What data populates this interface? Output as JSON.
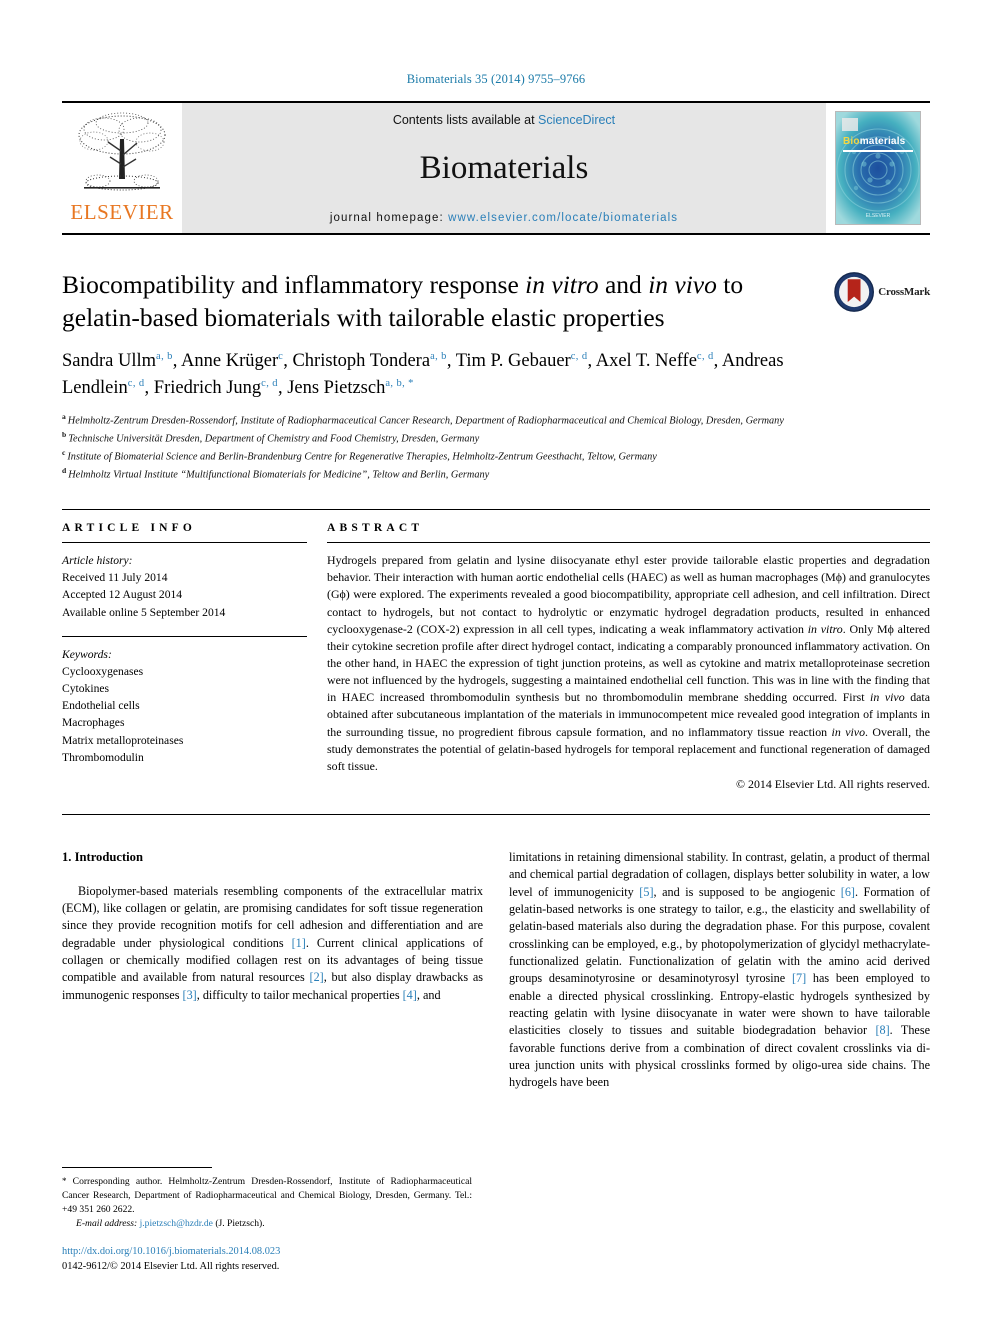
{
  "running_head": "Biomaterials 35 (2014) 9755–9766",
  "masthead": {
    "publisher": "ELSEVIER",
    "contents_prefix": "Contents lists available at ",
    "contents_link": "ScienceDirect",
    "journal_name": "Biomaterials",
    "homepage_prefix": "journal homepage: ",
    "homepage_url": "www.elsevier.com/locate/biomaterials",
    "cover": {
      "title_bio": "Bio",
      "title_materials": "materials",
      "footer": "ELSEVIER"
    }
  },
  "crossmark": {
    "label": "CrossMark"
  },
  "title": {
    "part1": "Biocompatibility and inflammatory response ",
    "em1": "in vitro",
    "part2": " and ",
    "em2": "in vivo",
    "part3": " to gelatin-based biomaterials with tailorable elastic properties"
  },
  "authors": [
    {
      "name": "Sandra Ullm",
      "sup": "a, b"
    },
    {
      "name": "Anne Krüger",
      "sup": "c"
    },
    {
      "name": "Christoph Tondera",
      "sup": "a, b"
    },
    {
      "name": "Tim P. Gebauer",
      "sup": "c, d"
    },
    {
      "name": "Axel T. Neffe",
      "sup": "c, d"
    },
    {
      "name": "Andreas Lendlein",
      "sup": "c, d"
    },
    {
      "name": "Friedrich Jung",
      "sup": "c, d"
    },
    {
      "name": "Jens Pietzsch",
      "sup": "a, b, *"
    }
  ],
  "affiliations": [
    {
      "mark": "a",
      "text": "Helmholtz-Zentrum Dresden-Rossendorf, Institute of Radiopharmaceutical Cancer Research, Department of Radiopharmaceutical and Chemical Biology, Dresden, Germany"
    },
    {
      "mark": "b",
      "text": "Technische Universität Dresden, Department of Chemistry and Food Chemistry, Dresden, Germany"
    },
    {
      "mark": "c",
      "text": "Institute of Biomaterial Science and Berlin-Brandenburg Centre for Regenerative Therapies, Helmholtz-Zentrum Geesthacht, Teltow, Germany"
    },
    {
      "mark": "d",
      "text": "Helmholtz Virtual Institute “Multifunctional Biomaterials for Medicine”, Teltow and Berlin, Germany"
    }
  ],
  "article_info": {
    "heading": "ARTICLE INFO",
    "history_label": "Article history:",
    "history": [
      "Received 11 July 2014",
      "Accepted 12 August 2014",
      "Available online 5 September 2014"
    ],
    "keywords_label": "Keywords:",
    "keywords": [
      "Cyclooxygenases",
      "Cytokines",
      "Endothelial cells",
      "Macrophages",
      "Matrix metalloproteinases",
      "Thrombomodulin"
    ]
  },
  "abstract": {
    "heading": "ABSTRACT",
    "p1": "Hydrogels prepared from gelatin and lysine diisocyanate ethyl ester provide tailorable elastic properties and degradation behavior. Their interaction with human aortic endothelial cells (HAEC) as well as human macrophages (Mϕ) and granulocytes (Gϕ) were explored. The experiments revealed a good biocompatibility, appropriate cell adhesion, and cell infiltration. Direct contact to hydrogels, but not contact to hydrolytic or enzymatic hydrogel degradation products, resulted in enhanced cyclooxygenase-2 (COX-2) expression in all cell types, indicating a weak inflammatory activation ",
    "em1": "in vitro",
    "p2": ". Only Mϕ altered their cytokine secretion profile after direct hydrogel contact, indicating a comparably pronounced inflammatory activation. On the other hand, in HAEC the expression of tight junction proteins, as well as cytokine and matrix metalloproteinase secretion were not influenced by the hydrogels, suggesting a maintained endothelial cell function. This was in line with the finding that in HAEC increased thrombomodulin synthesis but no thrombomodulin membrane shedding occurred. First ",
    "em2": "in vivo",
    "p3": " data obtained after subcutaneous implantation of the materials in immunocompetent mice revealed good integration of implants in the surrounding tissue, no progredient fibrous capsule formation, and no inflammatory tissue reaction ",
    "em3": "in vivo",
    "p4": ". Overall, the study demonstrates the potential of gelatin-based hydrogels for temporal replacement and functional regeneration of damaged soft tissue.",
    "copyright": "© 2014 Elsevier Ltd. All rights reserved."
  },
  "introduction": {
    "heading": "1. Introduction",
    "left_p1_a": "Biopolymer-based materials resembling components of the extracellular matrix (ECM), like collagen or gelatin, are promising candidates for soft tissue regeneration since they provide recognition motifs for cell adhesion and differentiation and are degradable under physiological conditions ",
    "ref1": "[1]",
    "left_p1_b": ". Current clinical applications of collagen or chemically modified collagen rest on its advantages of being tissue compatible and available from natural resources ",
    "ref2": "[2]",
    "left_p1_c": ", but also display drawbacks as immunogenic responses ",
    "ref3": "[3]",
    "left_p1_d": ", difficulty to tailor mechanical properties ",
    "ref4": "[4]",
    "left_p1_e": ", and",
    "right_a": "limitations in retaining dimensional stability. In contrast, gelatin, a product of thermal and chemical partial degradation of collagen, displays better solubility in water, a low level of immunogenicity ",
    "ref5": "[5]",
    "right_b": ", and is supposed to be angiogenic ",
    "ref6": "[6]",
    "right_c": ". Formation of gelatin-based networks is one strategy to tailor, e.g., the elasticity and swellability of gelatin-based materials also during the degradation phase. For this purpose, covalent crosslinking can be employed, e.g., by photopolymerization of glycidyl methacrylate-functionalized gelatin. Functionalization of gelatin with the amino acid derived groups desaminotyrosine or desaminotyrosyl tyrosine ",
    "ref7": "[7]",
    "right_d": " has been employed to enable a directed physical crosslinking. Entropy-elastic hydrogels synthesized by reacting gelatin with lysine diisocyanate in water were shown to have tailorable elasticities closely to tissues and suitable biodegradation behavior ",
    "ref8": "[8]",
    "right_e": ". These favorable functions derive from a combination of direct covalent crosslinks via di-urea junction units with physical crosslinks formed by oligo-urea side chains. The hydrogels have been"
  },
  "footnote": {
    "star": "*",
    "text": " Corresponding author. Helmholtz-Zentrum Dresden-Rossendorf, Institute of Radiopharmaceutical Cancer Research, Department of Radiopharmaceutical and Chemical Biology, Dresden, Germany. Tel.: +49 351 260 2622.",
    "email_label": "E-mail address:",
    "email": "j.pietzsch@hzdr.de",
    "email_suffix": " (J. Pietzsch)."
  },
  "doi_block": {
    "doi": "http://dx.doi.org/10.1016/j.biomaterials.2014.08.023",
    "issn_line": "0142-9612/© 2014 Elsevier Ltd. All rights reserved."
  },
  "colors": {
    "link_blue": "#2a7fb8",
    "elsevier_orange": "#E87722",
    "cover_teal": "#2f9bb5",
    "crossmark_blue": "#1f3a6e",
    "crossmark_red": "#b5241a"
  }
}
